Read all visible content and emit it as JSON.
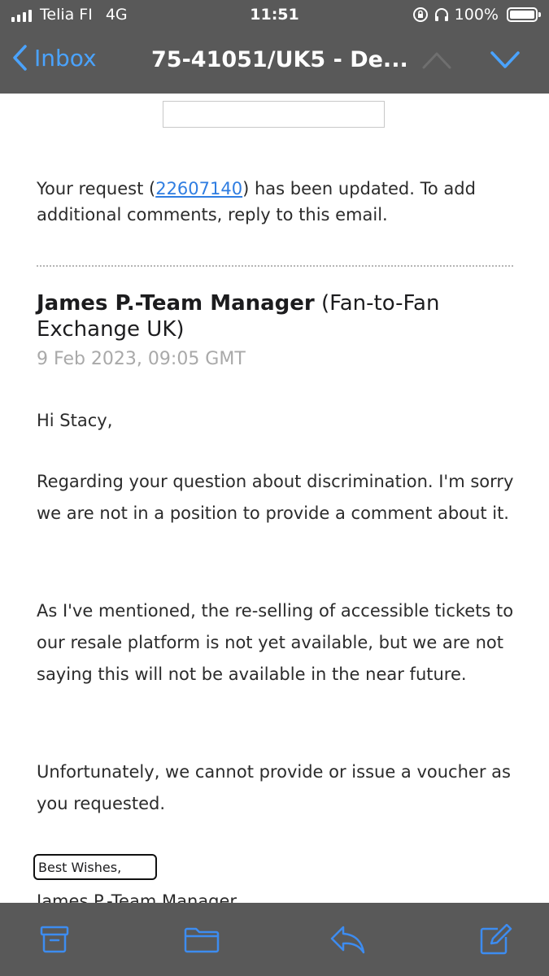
{
  "status_bar": {
    "carrier": "Telia FI",
    "network": "4G",
    "time": "11:51",
    "battery": "100%"
  },
  "nav": {
    "back_label": "Inbox",
    "title": "75-41051/UK5 - De..."
  },
  "email": {
    "intro_before": "Your request (",
    "ticket_number": "22607140",
    "intro_after": ") has been updated. To add additional comments, reply to this email.",
    "sender_name": "James P.-Team Manager",
    "sender_org": " (Fan-to-Fan Exchange UK)",
    "date": "9 Feb 2023, 09:05 GMT",
    "greeting": "Hi Stacy,",
    "paragraph_1": "Regarding your question about discrimination. I'm sorry we are not in a position to provide a comment about it.",
    "paragraph_2": "As I've mentioned, the re-selling of accessible tickets to our resale platform is not yet available, but we are not saying this will not be available in the near future.",
    "paragraph_3": "Unfortunately, we cannot provide or issue a voucher as you requested.",
    "closing": "Best Wishes,",
    "signature": "James P.-Team Manager"
  },
  "toolbar": {
    "icons": [
      "archive-icon",
      "folder-icon",
      "reply-icon",
      "compose-icon"
    ]
  },
  "colors": {
    "bar_background": "#595959",
    "accent_blue": "#4aa3ff",
    "link_blue": "#2f7de1",
    "date_gray": "#a9a9a9"
  }
}
